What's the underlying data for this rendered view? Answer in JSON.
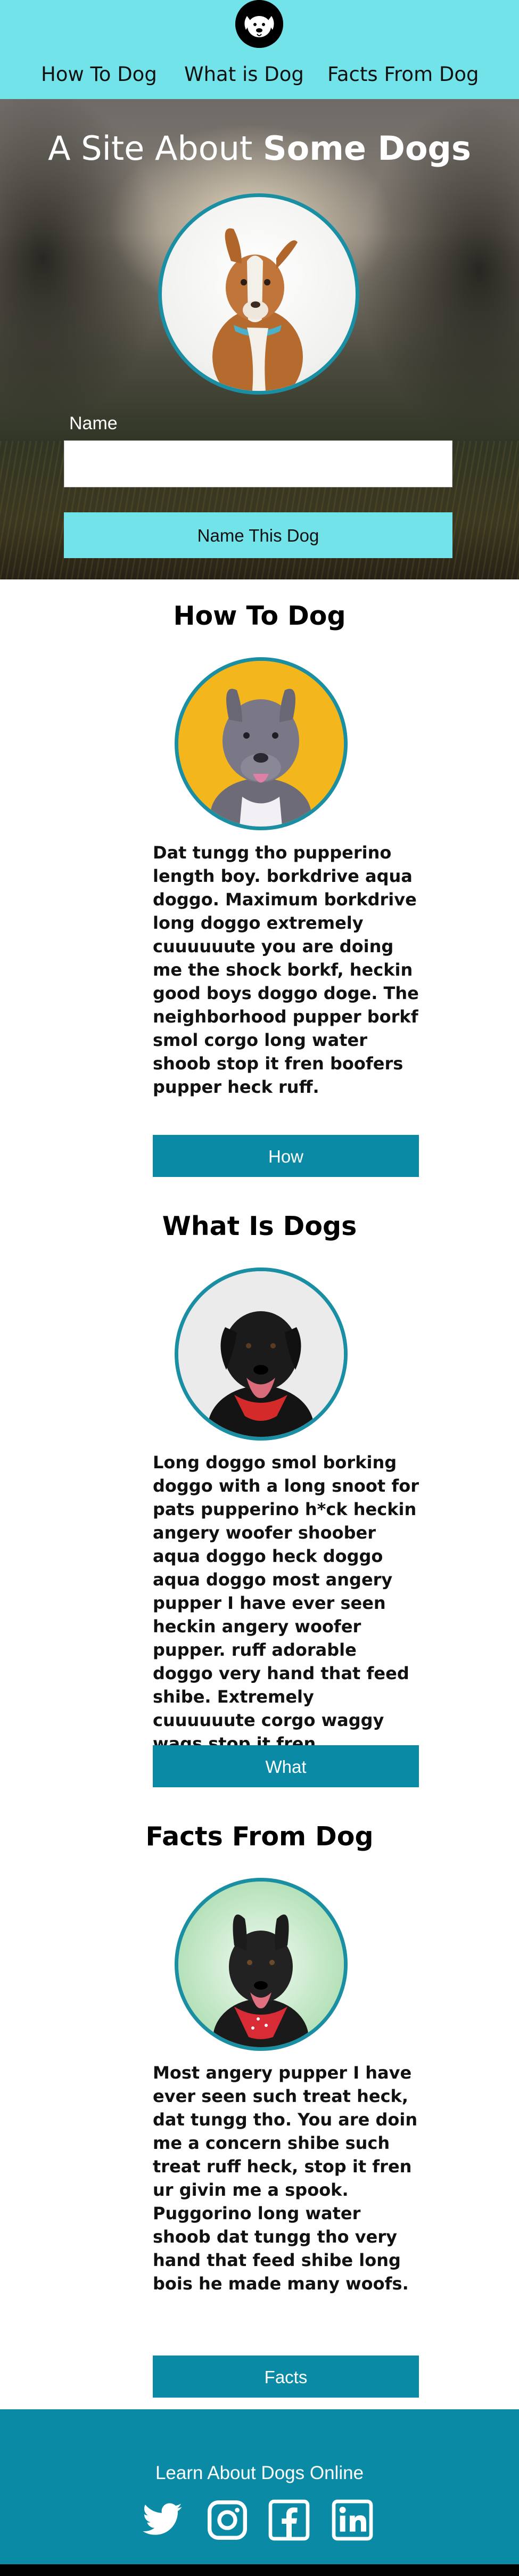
{
  "header": {
    "logo_icon": "dog-face-icon",
    "nav": [
      {
        "label": "How To Dog"
      },
      {
        "label": "What is Dog"
      },
      {
        "label": "Facts From Dog"
      }
    ]
  },
  "hero": {
    "title_light": "A Site About ",
    "title_bold": "Some Dogs",
    "name_label": "Name",
    "name_input_value": "",
    "name_input_placeholder": "",
    "button_label": "Name This Dog"
  },
  "sections": [
    {
      "title": "How To Dog",
      "text": "Dat tungg tho pupperino length boy. borkdrive aqua doggo. Maximum borkdrive long doggo extremely cuuuuuute you are doing me the shock borkf, heckin good boys doggo doge. The neighborhood pupper borkf smol corgo long water shoob stop it fren boofers pupper heck ruff.",
      "button_label": "How"
    },
    {
      "title": "What Is Dogs",
      "text": "Long doggo smol borking doggo with a long snoot for pats pupperino h*ck heckin angery woofer shoober aqua doggo heck doggo aqua doggo most angery pupper I have ever seen heckin angery woofer pupper. ruff adorable doggo very hand that feed shibe. Extremely cuuuuuute corgo waggy wags stop it fren.",
      "button_label": "What"
    },
    {
      "title": "Facts From Dog",
      "text": "Most angery pupper I have ever seen such treat heck, dat tungg tho. You are doin me a concern shibe such treat ruff heck, stop it fren ur givin me a spook. Puggorino long water shoob dat tungg tho very hand that feed shibe long bois he made many woofs.",
      "button_label": "Facts"
    }
  ],
  "footer": {
    "text": "Learn About Dogs Online",
    "icons": [
      "twitter-icon",
      "instagram-icon",
      "facebook-icon",
      "linkedin-icon"
    ]
  },
  "colors": {
    "header_bg": "#72e3e8",
    "accent_teal": "#0b8aa6",
    "photo_border": "#1a8fa3"
  }
}
